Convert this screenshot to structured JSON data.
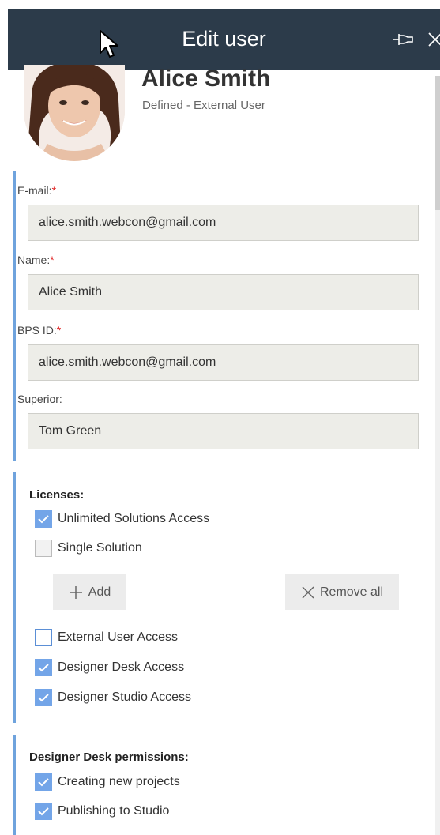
{
  "header": {
    "title": "Edit user",
    "pin_icon": "pin-icon",
    "close_icon": "close-icon"
  },
  "user": {
    "name": "Alice Smith",
    "type": "Defined - External User",
    "avatar_icon": "avatar"
  },
  "fields": [
    {
      "label": "E-mail:",
      "required": "*",
      "value": "alice.smith.webcon@gmail.com"
    },
    {
      "label": "Name:",
      "required": "*",
      "value": "Alice Smith"
    },
    {
      "label": "BPS ID:",
      "required": "*",
      "value": "alice.smith.webcon@gmail.com"
    },
    {
      "label": "Superior:",
      "required": "",
      "value": "Tom Green"
    }
  ],
  "licenses": {
    "title": "Licenses:",
    "items": [
      {
        "label": "Unlimited Solutions Access",
        "checked": true
      },
      {
        "label": "Single Solution",
        "checked": false
      }
    ],
    "add_label": "Add",
    "remove_all_label": "Remove all",
    "access": [
      {
        "label": "External User Access",
        "checked": false
      },
      {
        "label": "Designer Desk Access",
        "checked": true
      },
      {
        "label": "Designer Studio Access",
        "checked": true
      }
    ]
  },
  "designer_desk": {
    "title": "Designer Desk permissions:",
    "items": [
      {
        "label": "Creating new projects",
        "checked": true
      },
      {
        "label": "Publishing to Studio",
        "checked": true
      }
    ]
  },
  "colors": {
    "header_bg": "#2c3b4a",
    "accent": "#73a5e8",
    "section_bar": "#6fa3dd",
    "required": "#e02020"
  }
}
